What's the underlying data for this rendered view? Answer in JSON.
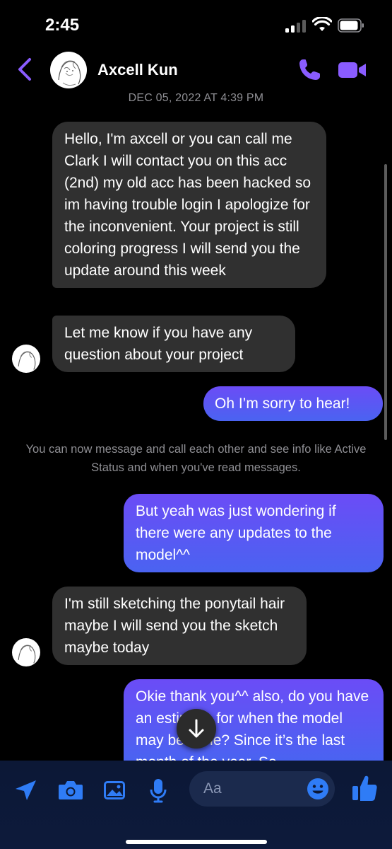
{
  "status_bar": {
    "time": "2:45"
  },
  "header": {
    "contact_name": "Axcell Kun",
    "date_divider": "DEC 05, 2022 AT 4:39 PM"
  },
  "messages": [
    {
      "direction": "incoming",
      "text": "Hello, I'm axcell or you can call me Clark I will contact you on this acc (2nd) my old acc has been hacked so im having trouble login I apologize for the inconvenient. Your project is still coloring progress I will send you the update around this week"
    },
    {
      "direction": "incoming",
      "text": "Let me know if you have any question about your project"
    },
    {
      "direction": "outgoing",
      "text": "Oh I’m sorry to hear!"
    },
    {
      "direction": "outgoing",
      "text": "But yeah was just wondering if there were any updates to the model^^"
    },
    {
      "direction": "incoming",
      "text": "I'm still sketching the ponytail hair maybe I will send you the sketch maybe today"
    },
    {
      "direction": "outgoing",
      "text": "Okie thank you^^ also, do you have an estimate for when the model may be done? Since it’s the last month of the year. So"
    }
  ],
  "system_note": "You can now message and call each other and see info like Active Status and when you've read messages.",
  "composer": {
    "placeholder": "Aa",
    "icons": [
      "location-arrow-icon",
      "camera-icon",
      "photo-icon",
      "microphone-icon",
      "emoji-icon",
      "thumbs-up-icon"
    ]
  },
  "colors": {
    "accent": "#8a5cff",
    "incoming_bubble": "#303030",
    "outgoing_bubble": "#5a5bf3",
    "composer_bg": "#0c1836"
  }
}
